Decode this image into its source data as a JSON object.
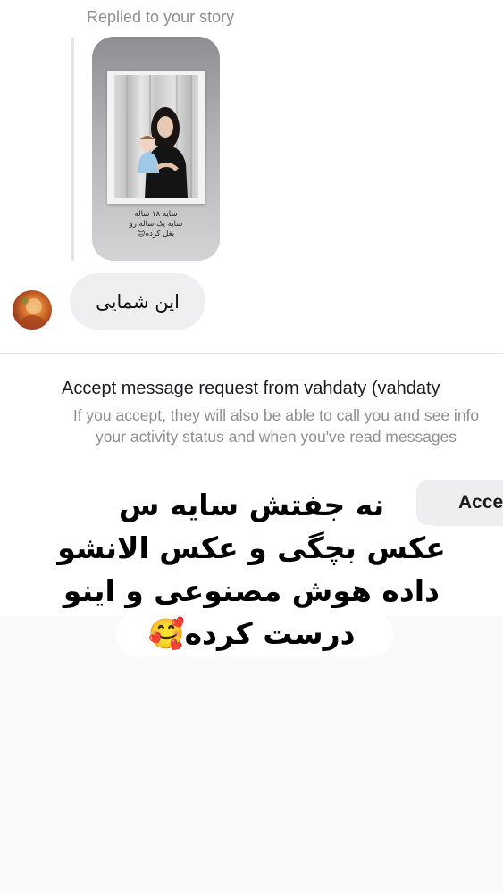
{
  "reply_header": {
    "label": "Replied to your story"
  },
  "story": {
    "caption_lines": [
      "سایه ۱۸ ساله",
      "سایه یک ساله رو",
      "بغل کرده😊"
    ]
  },
  "message": {
    "text": "این شمایی"
  },
  "request": {
    "title": "Accept message request from vahdaty (vahdaty",
    "description_lines": [
      "If you accept, they will also be able to call you and see info",
      "your activity status and when you've read messages"
    ],
    "accept_label": "Acce"
  },
  "overlay": {
    "lines": [
      "نه جفتش سایه س",
      "عکس بچگی و عکس الانشو",
      "داده هوش مصنوعی و اینو",
      "درست کرده🥰"
    ]
  }
}
